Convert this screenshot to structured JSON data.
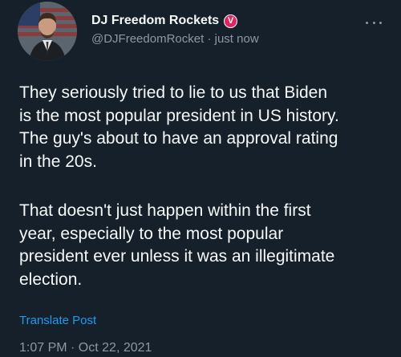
{
  "author": {
    "display_name": "DJ Freedom Rockets",
    "badge_letter": "V",
    "handle": "@DJFreedomRocket",
    "separator": "·",
    "relative_time": "just now",
    "badge_color": "#e0245e"
  },
  "post": {
    "paragraph_1_lines": [
      "They seriously tried to lie to us that Biden",
      "is the most popular president in US history.",
      "The guy's about to have an approval rating",
      "in the 20s."
    ],
    "paragraph_2_lines": [
      "That doesn't just happen within the first",
      "year, especially to the most popular",
      "president ever unless it was an illegitimate",
      "election."
    ]
  },
  "actions": {
    "translate_label": "Translate Post"
  },
  "meta": {
    "timestamp": "1:07 PM · Oct 22, 2021"
  },
  "icons": {
    "more": "more-options-icon",
    "verified": "verified-badge-icon"
  },
  "colors": {
    "background": "#15202b",
    "link": "#1d9bf0",
    "secondary_text": "#8b98a5"
  }
}
